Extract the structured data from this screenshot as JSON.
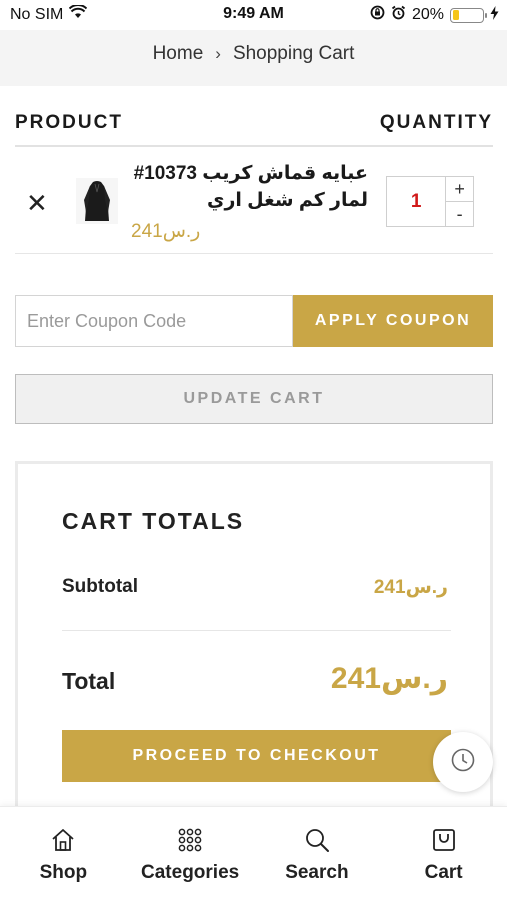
{
  "status_bar": {
    "carrier": "No SIM",
    "time": "9:49 AM",
    "battery": "20%"
  },
  "breadcrumb": {
    "home": "Home",
    "separator": "›",
    "current": "Shopping Cart"
  },
  "table": {
    "product_header": "PRODUCT",
    "quantity_header": "QUANTITY"
  },
  "cart_items": [
    {
      "name": "عبايه قماش كريب 10373# لمار كم شغل اري",
      "price": "241ر.س",
      "quantity": "1",
      "remove": "✕",
      "increase": "+",
      "decrease": "-"
    }
  ],
  "coupon": {
    "placeholder": "Enter Coupon Code",
    "button": "APPLY COUPON"
  },
  "update_cart": "UPDATE CART",
  "totals": {
    "title": "CART TOTALS",
    "subtotal_label": "Subtotal",
    "subtotal_value": "241ر.س",
    "total_label": "Total",
    "total_value": "241ر.س",
    "checkout": "PROCEED TO CHECKOUT"
  },
  "bottom_nav": [
    {
      "label": "Shop",
      "icon": "shop-icon"
    },
    {
      "label": "Categories",
      "icon": "categories-icon"
    },
    {
      "label": "Search",
      "icon": "search-icon"
    },
    {
      "label": "Cart",
      "icon": "cart-icon"
    }
  ],
  "colors": {
    "accent": "#c9a646",
    "qty_text": "#d11a1a"
  }
}
